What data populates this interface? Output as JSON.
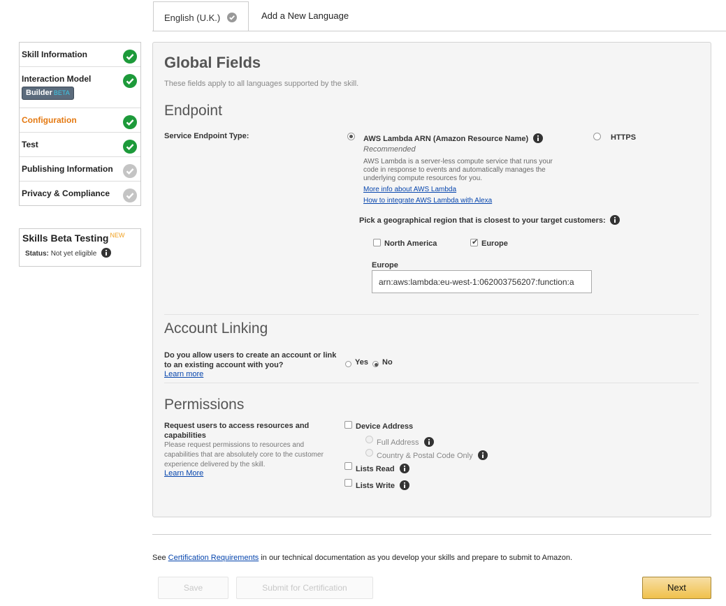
{
  "tabs": {
    "active_label": "English (U.K.)",
    "add_label": "Add a New Language"
  },
  "sidebar": {
    "items": [
      {
        "label": "Skill Information",
        "status": "complete"
      },
      {
        "label": "Interaction Model",
        "status": "complete",
        "badge": "Builder",
        "badge_sup": "BETA"
      },
      {
        "label": "Configuration",
        "status": "complete",
        "active": true
      },
      {
        "label": "Test",
        "status": "complete"
      },
      {
        "label": "Publishing Information",
        "status": "incomplete"
      },
      {
        "label": "Privacy & Compliance",
        "status": "incomplete"
      }
    ]
  },
  "beta_testing": {
    "title": "Skills Beta Testing",
    "new_badge": "NEW",
    "status_label": "Status:",
    "status_value": "Not yet eligible"
  },
  "global": {
    "title": "Global Fields",
    "subtitle": "These fields apply to all languages supported by the skill."
  },
  "endpoint": {
    "heading": "Endpoint",
    "type_label": "Service Endpoint Type:",
    "lambda_label": "AWS Lambda ARN (Amazon Resource Name)",
    "recommended": "Recommended",
    "description": "AWS Lambda is a server-less compute service that runs your code in response to events and automatically manages the underlying compute resources for you.",
    "link_more": "More info about AWS Lambda",
    "link_integrate": "How to integrate AWS Lambda with Alexa",
    "https_label": "HTTPS",
    "region_prompt": "Pick a geographical region that is closest to your target customers:",
    "region_na": "North America",
    "region_eu": "Europe",
    "eu_field_label": "Europe",
    "eu_field_value": "arn:aws:lambda:eu-west-1:062003756207:function:a"
  },
  "account_linking": {
    "heading": "Account Linking",
    "question": "Do you allow users to create an account or link to an existing account with you?",
    "learn_more": "Learn more",
    "yes": "Yes",
    "no": "No"
  },
  "permissions": {
    "heading": "Permissions",
    "title": "Request users to access resources and capabilities",
    "description": "Please request permissions to resources and capabilities that are absolutely core to the customer experience delivered by the skill.",
    "learn_more": "Learn More",
    "device_address": "Device Address",
    "full_address": "Full Address",
    "country_postal": "Country & Postal Code Only",
    "lists_read": "Lists Read",
    "lists_write": "Lists Write"
  },
  "footer": {
    "see": "See",
    "cert_link": "Certification Requirements",
    "rest": "in our technical documentation as you develop your skills and prepare to submit to Amazon.",
    "save": "Save",
    "submit": "Submit for Certification",
    "next": "Next"
  },
  "colors": {
    "complete_green": "#1d9a3a",
    "incomplete_grey": "#c4c4c4",
    "active_orange": "#e47911",
    "link_blue": "#0645ad"
  },
  "icons": {
    "complete": "check-circle-icon",
    "incomplete": "check-circle-grey-icon",
    "info": "info-icon"
  }
}
